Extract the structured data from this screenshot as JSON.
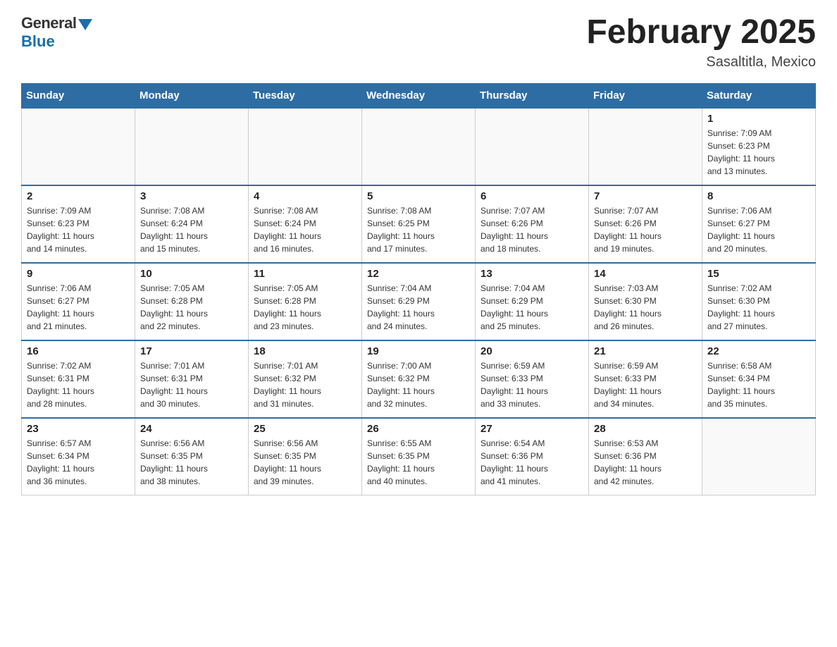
{
  "header": {
    "logo_general": "General",
    "logo_blue": "Blue",
    "title": "February 2025",
    "subtitle": "Sasaltitla, Mexico"
  },
  "calendar": {
    "days_of_week": [
      "Sunday",
      "Monday",
      "Tuesday",
      "Wednesday",
      "Thursday",
      "Friday",
      "Saturday"
    ],
    "weeks": [
      [
        {
          "date": "",
          "info": ""
        },
        {
          "date": "",
          "info": ""
        },
        {
          "date": "",
          "info": ""
        },
        {
          "date": "",
          "info": ""
        },
        {
          "date": "",
          "info": ""
        },
        {
          "date": "",
          "info": ""
        },
        {
          "date": "1",
          "info": "Sunrise: 7:09 AM\nSunset: 6:23 PM\nDaylight: 11 hours\nand 13 minutes."
        }
      ],
      [
        {
          "date": "2",
          "info": "Sunrise: 7:09 AM\nSunset: 6:23 PM\nDaylight: 11 hours\nand 14 minutes."
        },
        {
          "date": "3",
          "info": "Sunrise: 7:08 AM\nSunset: 6:24 PM\nDaylight: 11 hours\nand 15 minutes."
        },
        {
          "date": "4",
          "info": "Sunrise: 7:08 AM\nSunset: 6:24 PM\nDaylight: 11 hours\nand 16 minutes."
        },
        {
          "date": "5",
          "info": "Sunrise: 7:08 AM\nSunset: 6:25 PM\nDaylight: 11 hours\nand 17 minutes."
        },
        {
          "date": "6",
          "info": "Sunrise: 7:07 AM\nSunset: 6:26 PM\nDaylight: 11 hours\nand 18 minutes."
        },
        {
          "date": "7",
          "info": "Sunrise: 7:07 AM\nSunset: 6:26 PM\nDaylight: 11 hours\nand 19 minutes."
        },
        {
          "date": "8",
          "info": "Sunrise: 7:06 AM\nSunset: 6:27 PM\nDaylight: 11 hours\nand 20 minutes."
        }
      ],
      [
        {
          "date": "9",
          "info": "Sunrise: 7:06 AM\nSunset: 6:27 PM\nDaylight: 11 hours\nand 21 minutes."
        },
        {
          "date": "10",
          "info": "Sunrise: 7:05 AM\nSunset: 6:28 PM\nDaylight: 11 hours\nand 22 minutes."
        },
        {
          "date": "11",
          "info": "Sunrise: 7:05 AM\nSunset: 6:28 PM\nDaylight: 11 hours\nand 23 minutes."
        },
        {
          "date": "12",
          "info": "Sunrise: 7:04 AM\nSunset: 6:29 PM\nDaylight: 11 hours\nand 24 minutes."
        },
        {
          "date": "13",
          "info": "Sunrise: 7:04 AM\nSunset: 6:29 PM\nDaylight: 11 hours\nand 25 minutes."
        },
        {
          "date": "14",
          "info": "Sunrise: 7:03 AM\nSunset: 6:30 PM\nDaylight: 11 hours\nand 26 minutes."
        },
        {
          "date": "15",
          "info": "Sunrise: 7:02 AM\nSunset: 6:30 PM\nDaylight: 11 hours\nand 27 minutes."
        }
      ],
      [
        {
          "date": "16",
          "info": "Sunrise: 7:02 AM\nSunset: 6:31 PM\nDaylight: 11 hours\nand 28 minutes."
        },
        {
          "date": "17",
          "info": "Sunrise: 7:01 AM\nSunset: 6:31 PM\nDaylight: 11 hours\nand 30 minutes."
        },
        {
          "date": "18",
          "info": "Sunrise: 7:01 AM\nSunset: 6:32 PM\nDaylight: 11 hours\nand 31 minutes."
        },
        {
          "date": "19",
          "info": "Sunrise: 7:00 AM\nSunset: 6:32 PM\nDaylight: 11 hours\nand 32 minutes."
        },
        {
          "date": "20",
          "info": "Sunrise: 6:59 AM\nSunset: 6:33 PM\nDaylight: 11 hours\nand 33 minutes."
        },
        {
          "date": "21",
          "info": "Sunrise: 6:59 AM\nSunset: 6:33 PM\nDaylight: 11 hours\nand 34 minutes."
        },
        {
          "date": "22",
          "info": "Sunrise: 6:58 AM\nSunset: 6:34 PM\nDaylight: 11 hours\nand 35 minutes."
        }
      ],
      [
        {
          "date": "23",
          "info": "Sunrise: 6:57 AM\nSunset: 6:34 PM\nDaylight: 11 hours\nand 36 minutes."
        },
        {
          "date": "24",
          "info": "Sunrise: 6:56 AM\nSunset: 6:35 PM\nDaylight: 11 hours\nand 38 minutes."
        },
        {
          "date": "25",
          "info": "Sunrise: 6:56 AM\nSunset: 6:35 PM\nDaylight: 11 hours\nand 39 minutes."
        },
        {
          "date": "26",
          "info": "Sunrise: 6:55 AM\nSunset: 6:35 PM\nDaylight: 11 hours\nand 40 minutes."
        },
        {
          "date": "27",
          "info": "Sunrise: 6:54 AM\nSunset: 6:36 PM\nDaylight: 11 hours\nand 41 minutes."
        },
        {
          "date": "28",
          "info": "Sunrise: 6:53 AM\nSunset: 6:36 PM\nDaylight: 11 hours\nand 42 minutes."
        },
        {
          "date": "",
          "info": ""
        }
      ]
    ]
  }
}
